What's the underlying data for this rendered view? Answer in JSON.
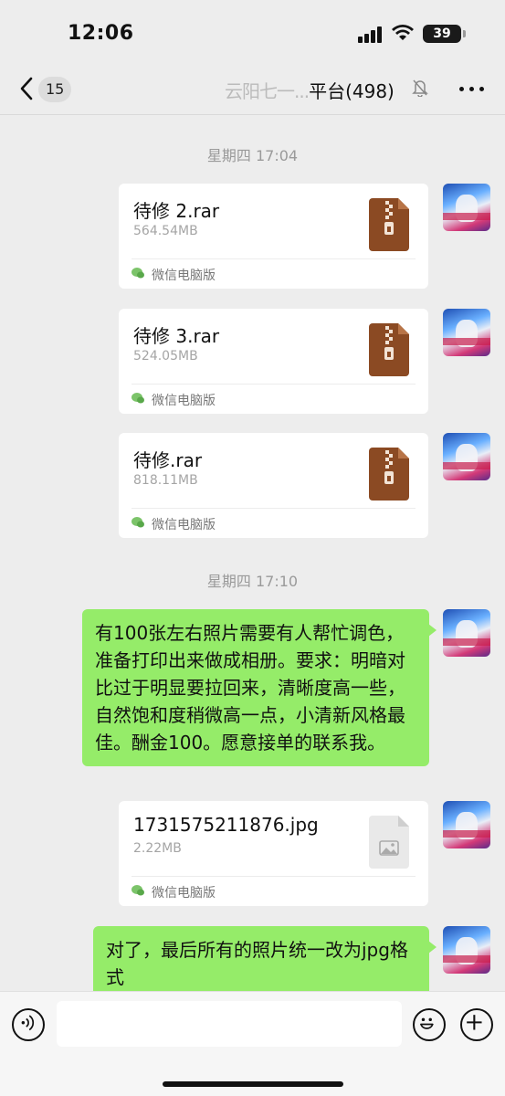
{
  "status_bar": {
    "time": "12:06",
    "battery": "39"
  },
  "nav": {
    "back_badge": "15",
    "title_obscured": "云阳七一...",
    "title_visible": "平台(498)"
  },
  "messages": {
    "timestamp_1": "星期四 17:04",
    "file_1": {
      "name": "待修 2.rar",
      "size": "564.54MB",
      "source": "微信电脑版"
    },
    "file_2": {
      "name": "待修 3.rar",
      "size": "524.05MB",
      "source": "微信电脑版"
    },
    "file_3": {
      "name": "待修.rar",
      "size": "818.11MB",
      "source": "微信电脑版"
    },
    "timestamp_2": "星期四 17:10",
    "text_1": "有100张左右照片需要有人帮忙调色，准备打印出来做成相册。要求：明暗对比过于明显要拉回来，清晰度高一些，自然饱和度稍微高一点，小清新风格最佳。酬金100。愿意接单的联系我。",
    "file_4": {
      "name": "1731575211876.jpg",
      "size": "2.22MB",
      "source": "微信电脑版"
    },
    "text_2": "对了，最后所有的照片统一改为jpg格式"
  },
  "colors": {
    "bubble_green": "#95ec69",
    "background": "#ededed",
    "rar_brown": "#8b4a23"
  }
}
